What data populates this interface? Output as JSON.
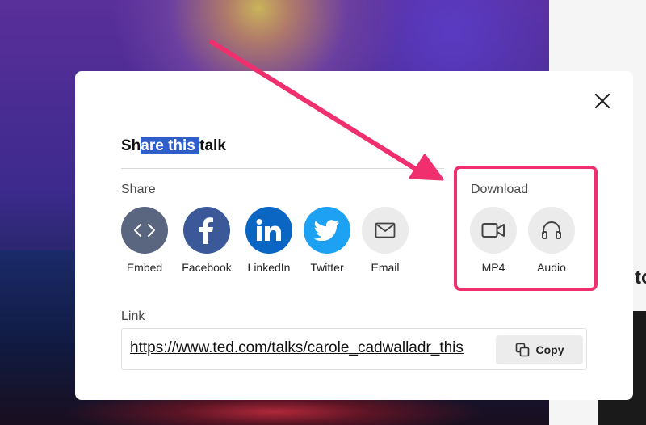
{
  "modal": {
    "title_prefix": "Sh",
    "title_highlight": "are this ",
    "title_suffix": "talk",
    "close_icon": "close-icon"
  },
  "share": {
    "label": "Share",
    "options": [
      {
        "label": "Embed",
        "icon": "code-icon",
        "color": "#5a6580"
      },
      {
        "label": "Facebook",
        "icon": "facebook-icon",
        "color": "#3b5998"
      },
      {
        "label": "LinkedIn",
        "icon": "linkedin-icon",
        "color": "#0a66c2"
      },
      {
        "label": "Twitter",
        "icon": "twitter-icon",
        "color": "#1da1f2"
      },
      {
        "label": "Email",
        "icon": "mail-icon",
        "color": "#ebebeb"
      }
    ]
  },
  "download": {
    "label": "Download",
    "options": [
      {
        "label": "MP4",
        "icon": "video-camera-icon"
      },
      {
        "label": "Audio",
        "icon": "headphones-icon"
      }
    ]
  },
  "link": {
    "label": "Link",
    "url": "https://www.ted.com/talks/carole_cadwalladr_this",
    "copy_label": "Copy",
    "copy_icon": "copy-icon"
  },
  "background": {
    "fragment_text": "tc"
  },
  "annotation": {
    "color": "#f0306e"
  }
}
